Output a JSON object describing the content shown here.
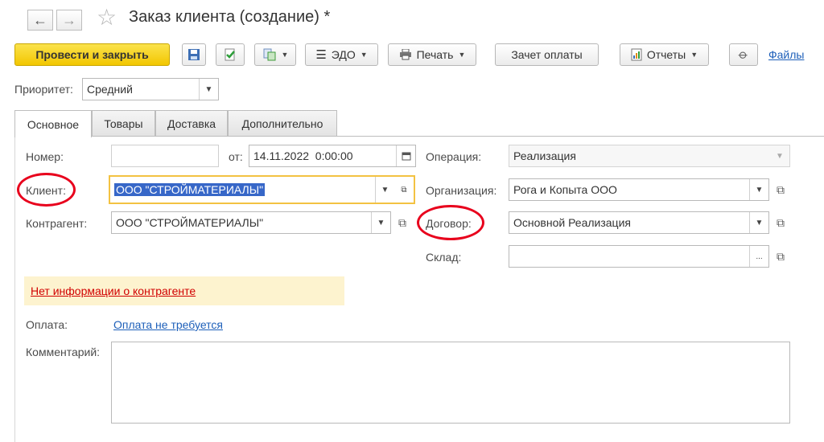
{
  "window": {
    "title": "Заказ клиента (создание) *"
  },
  "nav": {
    "back": "←",
    "forward": "→",
    "star": "☆"
  },
  "toolbar": {
    "post_close": "Провести и закрыть",
    "edo": "ЭДО",
    "print": "Печать",
    "payment_offset": "Зачет оплаты",
    "reports": "Отчеты",
    "files": "Файлы"
  },
  "priority": {
    "label": "Приоритет:",
    "value": "Средний"
  },
  "tabs": [
    {
      "label": "Основное"
    },
    {
      "label": "Товары"
    },
    {
      "label": "Доставка"
    },
    {
      "label": "Дополнительно"
    }
  ],
  "form": {
    "number": {
      "label": "Номер:",
      "value": ""
    },
    "date": {
      "label": "от:",
      "value": "14.11.2022  0:00:00"
    },
    "operation": {
      "label": "Операция:",
      "value": "Реализация"
    },
    "client": {
      "label": "Клиент:",
      "value": "ООО \"СТРОЙМАТЕРИАЛЫ\""
    },
    "organization": {
      "label": "Организация:",
      "value": "Рога и Копыта ООО"
    },
    "counterparty": {
      "label": "Контрагент:",
      "value": "ООО \"СТРОЙМАТЕРИАЛЫ\""
    },
    "contract": {
      "label": "Договор:",
      "value": "Основной Реализация"
    },
    "warehouse": {
      "label": "Склад:",
      "value": ""
    },
    "notice": "Нет информации о контрагенте",
    "payment": {
      "label": "Оплата:",
      "value": "Оплата не требуется"
    },
    "comment": {
      "label": "Комментарий:",
      "value": ""
    }
  },
  "colors": {
    "highlight": "#e8001c",
    "primary_button": "#f2c600",
    "link": "#1d5fb9"
  }
}
